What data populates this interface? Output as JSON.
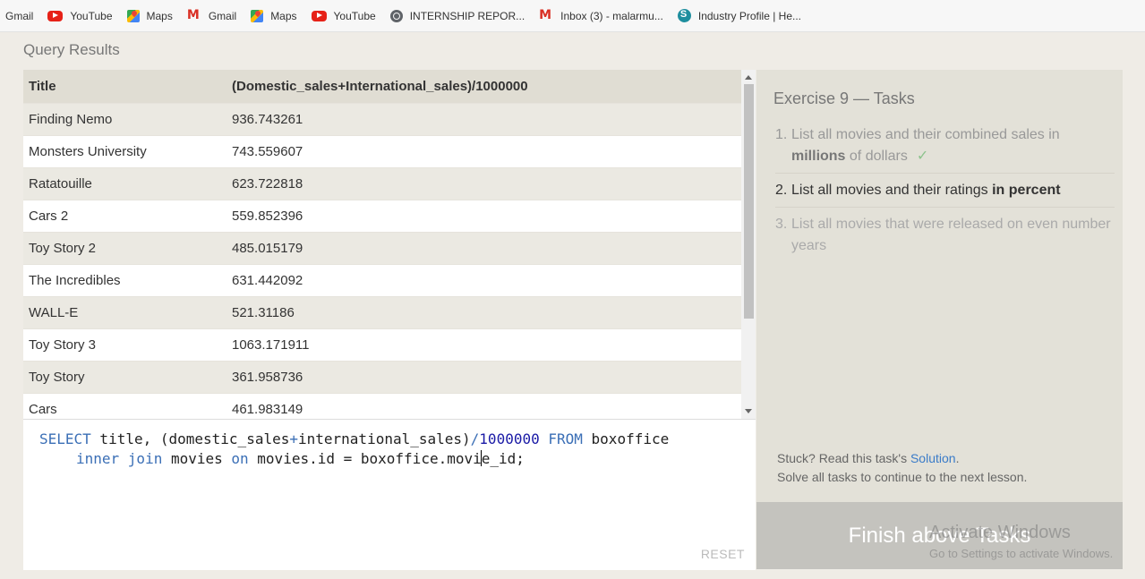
{
  "bookmarks": [
    {
      "icon": "none",
      "label": "Gmail"
    },
    {
      "icon": "youtube-icon",
      "label": "YouTube"
    },
    {
      "icon": "maps-icon",
      "label": "Maps"
    },
    {
      "icon": "gmail-icon",
      "label": "Gmail"
    },
    {
      "icon": "maps-icon",
      "label": "Maps"
    },
    {
      "icon": "youtube-icon",
      "label": "YouTube"
    },
    {
      "icon": "globe-icon",
      "label": "INTERNSHIP REPOR..."
    },
    {
      "icon": "gmail-icon",
      "label": "Inbox (3) - malarmu..."
    },
    {
      "icon": "industry-icon",
      "label": "Industry Profile | He..."
    }
  ],
  "query_results": {
    "title": "Query Results",
    "columns": [
      "Title",
      "(Domestic_sales+International_sales)/1000000"
    ],
    "rows": [
      [
        "Finding Nemo",
        "936.743261"
      ],
      [
        "Monsters University",
        "743.559607"
      ],
      [
        "Ratatouille",
        "623.722818"
      ],
      [
        "Cars 2",
        "559.852396"
      ],
      [
        "Toy Story 2",
        "485.015179"
      ],
      [
        "The Incredibles",
        "631.442092"
      ],
      [
        "WALL-E",
        "521.31186"
      ],
      [
        "Toy Story 3",
        "1063.171911"
      ],
      [
        "Toy Story",
        "361.958736"
      ],
      [
        "Cars",
        "461.983149"
      ]
    ]
  },
  "editor": {
    "line1": {
      "kw1": "SELECT",
      "t1": " title, (domestic_sales",
      "op": "+",
      "t2": "international_sales)",
      "slash": "/",
      "num": "1000000",
      "sp": " ",
      "kw2": "FROM",
      "t3": " boxoffice"
    },
    "line2": {
      "kw1": "inner join",
      "t1": " movies ",
      "kw2": "on",
      "t2": " movies.id = boxoffice.movi",
      "t3": "e_id;"
    },
    "reset_label": "RESET"
  },
  "tasks": {
    "title": "Exercise 9 — Tasks",
    "items": [
      {
        "num": "1.",
        "pre": "List all movies and their combined sales in ",
        "bold": "millions",
        "post": " of dollars",
        "check": "✓"
      },
      {
        "num": "2.",
        "pre": "List all movies and their ratings ",
        "bold": "in percent"
      },
      {
        "num": "3.",
        "text": "List all movies that were released on even number years"
      }
    ],
    "stuck_text": "Stuck? Read this task's ",
    "solution_link": "Solution",
    "stuck_end": ".",
    "continue_text": "Solve all tasks to continue to the next lesson.",
    "finish_label": "Finish above Tasks"
  },
  "watermark": {
    "title": "Activate Windows",
    "subtitle": "Go to Settings to activate Windows."
  }
}
